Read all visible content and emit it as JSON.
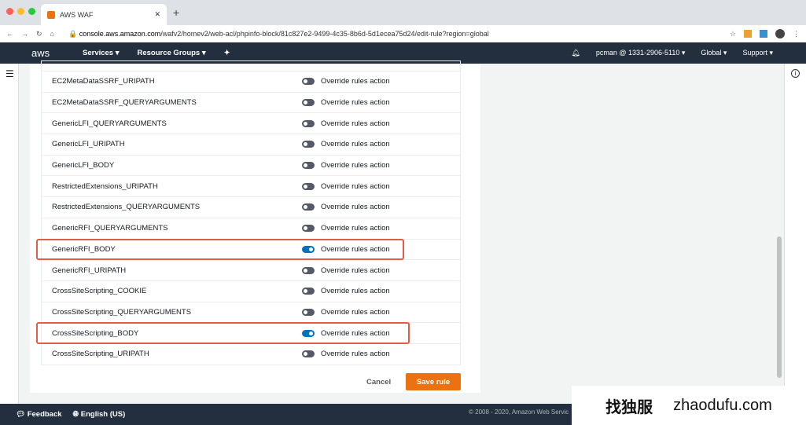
{
  "browser": {
    "tab_title": "AWS WAF",
    "url_host": "console.aws.amazon.com",
    "url_path": "/wafv2/homev2/web-acl/phpinfo-block/81c827e2-9499-4c35-8b6d-5d1ecea75d24/edit-rule?region=global"
  },
  "nav": {
    "logo": "aws",
    "services": "Services ▾",
    "resource_groups": "Resource Groups ▾",
    "account": "pcman @ 1331-2906-5110 ▾",
    "region": "Global ▾",
    "support": "Support ▾"
  },
  "rules": [
    {
      "name": "EC2MetaDataSSRF_URIPATH",
      "action": "Override rules action",
      "on": false
    },
    {
      "name": "EC2MetaDataSSRF_QUERYARGUMENTS",
      "action": "Override rules action",
      "on": false
    },
    {
      "name": "GenericLFI_QUERYARGUMENTS",
      "action": "Override rules action",
      "on": false
    },
    {
      "name": "GenericLFI_URIPATH",
      "action": "Override rules action",
      "on": false
    },
    {
      "name": "GenericLFI_BODY",
      "action": "Override rules action",
      "on": false
    },
    {
      "name": "RestrictedExtensions_URIPATH",
      "action": "Override rules action",
      "on": false
    },
    {
      "name": "RestrictedExtensions_QUERYARGUMENTS",
      "action": "Override rules action",
      "on": false
    },
    {
      "name": "GenericRFI_QUERYARGUMENTS",
      "action": "Override rules action",
      "on": false
    },
    {
      "name": "GenericRFI_BODY",
      "action": "Override rules action",
      "on": true
    },
    {
      "name": "GenericRFI_URIPATH",
      "action": "Override rules action",
      "on": false
    },
    {
      "name": "CrossSiteScripting_COOKIE",
      "action": "Override rules action",
      "on": false
    },
    {
      "name": "CrossSiteScripting_QUERYARGUMENTS",
      "action": "Override rules action",
      "on": false
    },
    {
      "name": "CrossSiteScripting_BODY",
      "action": "Override rules action",
      "on": true
    },
    {
      "name": "CrossSiteScripting_URIPATH",
      "action": "Override rules action",
      "on": false
    }
  ],
  "actions": {
    "cancel": "Cancel",
    "save": "Save rule"
  },
  "footer": {
    "feedback": "Feedback",
    "language": "English (US)",
    "copyright": "© 2008 - 2020, Amazon Web Servic"
  },
  "watermark": {
    "cn": "找独服",
    "site": "zhaodufu.com"
  },
  "colors": {
    "accent": "#ec7211",
    "toggle_on": "#0073bb",
    "highlight": "#e25c47"
  }
}
